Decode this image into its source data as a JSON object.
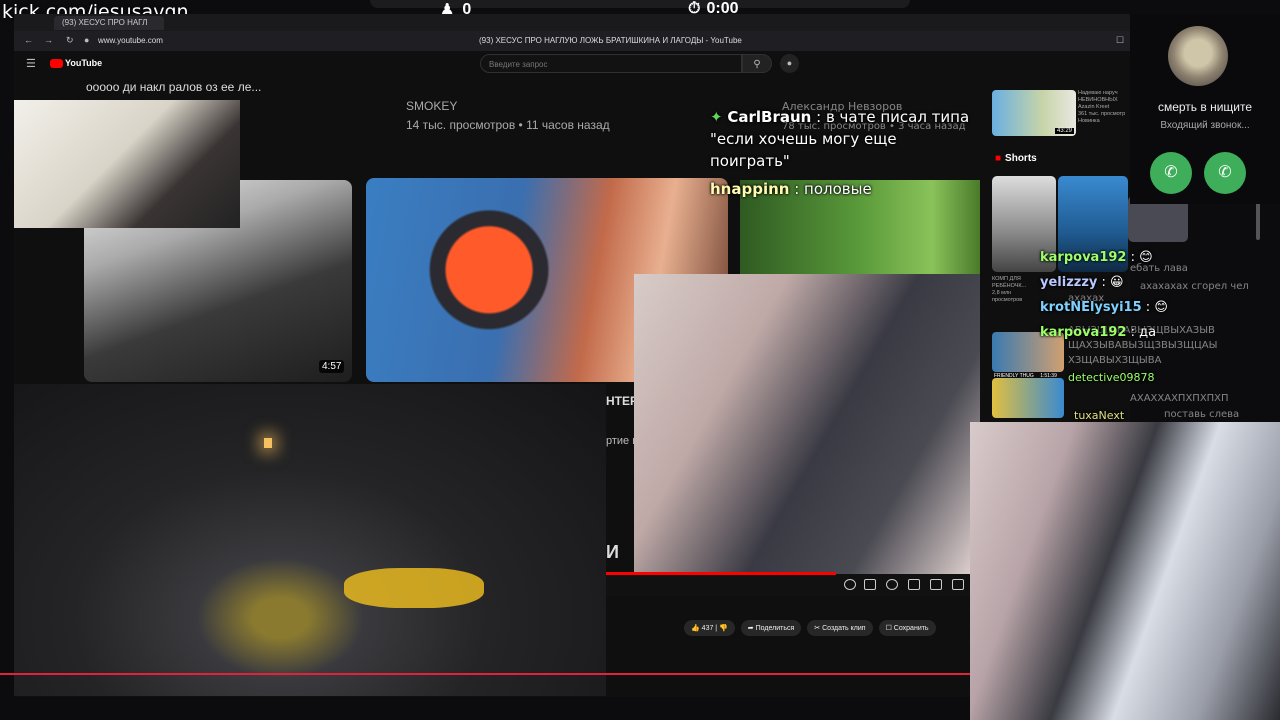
{
  "overlay": {
    "kick_url": "kick.com/jesusavgn",
    "viewers": "0",
    "timer": "0:00"
  },
  "browser": {
    "tab_title": "(93) ХЕСУС ПРО НАГЛ",
    "url": "www.youtube.com",
    "page_title": "(93) ХЕСУС ПРО НАГЛУЮ ЛОЖЬ БРАТИШКИНА И ЛАГОДЫ - YouTube"
  },
  "youtube": {
    "logo": "YouTube",
    "search_placeholder": "Введите запрос",
    "channel_name": "SMOKEY",
    "video_meta": "14 тыс. просмотров • 11 часов назад",
    "duration": "4:57",
    "shorts_label": "Shorts",
    "actions": [
      "437",
      "Поделиться",
      "Создать клип",
      "Сохранить"
    ],
    "sidebar_video_text": [
      "Надеваю наруч",
      "НЕВИНОВНЫХ",
      "Azazin Kreet",
      "361 тыс. просмотр",
      "Новинка"
    ],
    "short_caption": [
      "КОМП ДЛЯ",
      "РЕБЁНОЧК...",
      "2,8 млн",
      "просмотров"
    ],
    "side_duration": "43:29",
    "side_label": "FRIENDLY THUG",
    "side_duration2": "1:51:39",
    "cut_texts": [
      "НТЕР",
      "ртие и",
      "И"
    ],
    "top_cut_title": "ооооо ди накл ралов оз ее ле...",
    "chat_header_ghost": "Александр Невзоров",
    "chat_header_meta": "78 тыс. просмотров • 3 часа назад"
  },
  "chat_top": [
    {
      "user": "CarlBraun",
      "msg": "в чате писал типа"
    },
    {
      "user": "",
      "msg": "\"если хочешь могу еще"
    },
    {
      "user": "",
      "msg": "поиграть\""
    },
    {
      "user": "hnappinn",
      "msg": "половые"
    }
  ],
  "chat_right": [
    {
      "user": "karpova192",
      "msg": "",
      "color": "#9cff6a"
    },
    {
      "user": "yelizzzy",
      "msg": "",
      "color": "#b9c8ff"
    },
    {
      "user": "krotNElysyi15",
      "msg": "",
      "color": "#7fd0ff"
    },
    {
      "user": "karpova192",
      "msg": "да",
      "color": "#9cff6a"
    }
  ],
  "chat_ghost": [
    "ебать лава",
    "ахахахах сгорел чел",
    "ахахах",
    "АВЫЗЩЫВАВЫЗЩВЫХАЗЫВ",
    "ЩАХЗЫВАВЫЗЩЗВЫЗЩЦАЫ",
    "ХЗЩАВЫХЗЩЫВА",
    "detective09878",
    "АХАХХАХПХПХПХП",
    "tuxaNext",
    "поставь слева"
  ],
  "call": {
    "name": "смерть в нищите",
    "status": "Входящий звонок..."
  },
  "colors": {
    "accent_red": "#e0233a",
    "call_green": "#3fae5a",
    "chat_green": "#9cff6a"
  }
}
